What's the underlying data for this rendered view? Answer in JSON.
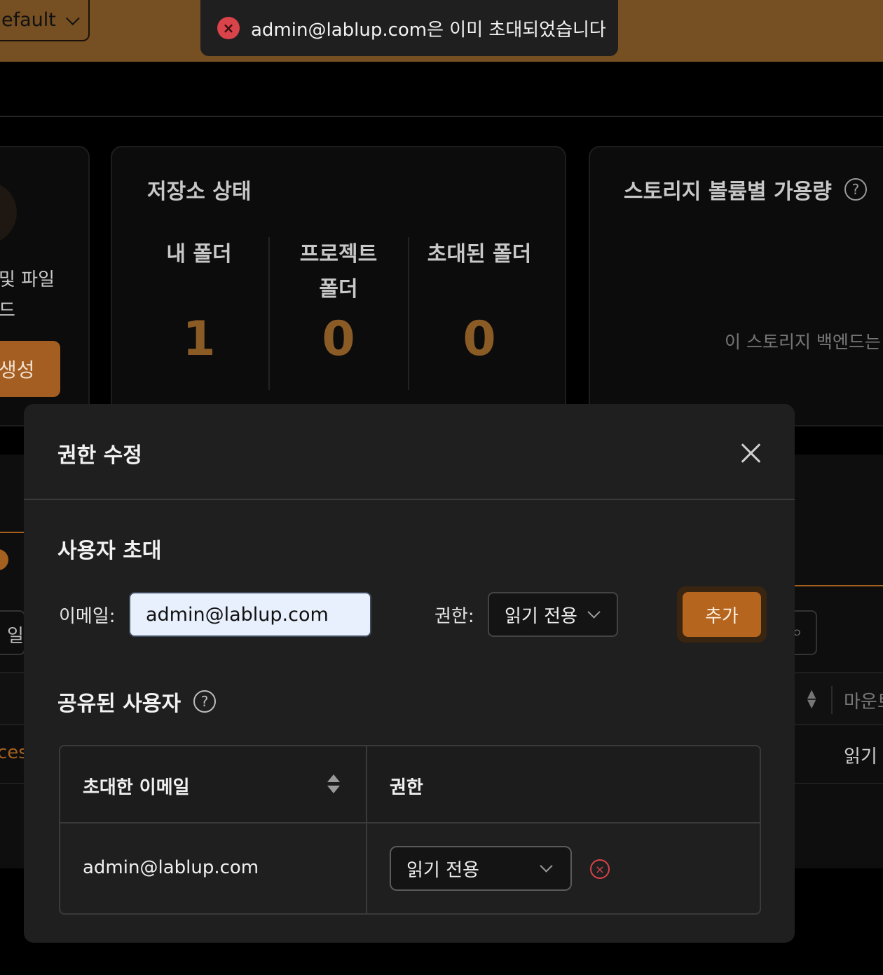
{
  "topbar": {
    "project_selector": "efault",
    "toast": "admin@lablup.com은 이미 초대되었습니다"
  },
  "summary_card": {
    "text_line1": "및 파일",
    "text_line2": "드",
    "button": "생성"
  },
  "storage_status": {
    "title": "저장소 상태",
    "stats": [
      {
        "label_line1": "내 폴더",
        "label_line2": "",
        "value": "1"
      },
      {
        "label_line1": "프로젝트",
        "label_line2": "폴더",
        "value": "0"
      },
      {
        "label_line1": "초대된 폴더",
        "label_line2": "",
        "value": "0"
      }
    ]
  },
  "volume_card": {
    "title": "스토리지 볼륨별 가용량",
    "note": "이 스토리지 백엔드는"
  },
  "background_table": {
    "search_fragment": "일",
    "mount_header": "마운트",
    "row_name_fragment": "ces",
    "row_permission": "읽기"
  },
  "modal": {
    "title": "권한 수정",
    "invite_section": {
      "title": "사용자 초대",
      "email_label": "이메일:",
      "email_value": "admin@lablup.com",
      "permission_label": "권한:",
      "permission_value": "읽기 전용",
      "add_button": "추가"
    },
    "shared_section": {
      "title": "공유된 사용자",
      "columns": [
        "초대한 이메일",
        "권한"
      ],
      "rows": [
        {
          "email": "admin@lablup.com",
          "permission": "읽기 전용"
        }
      ]
    }
  },
  "colors": {
    "accent": "#b5651e",
    "topbar": "#764f22",
    "error": "#d9434a",
    "stat_value": "#8b5b26"
  }
}
